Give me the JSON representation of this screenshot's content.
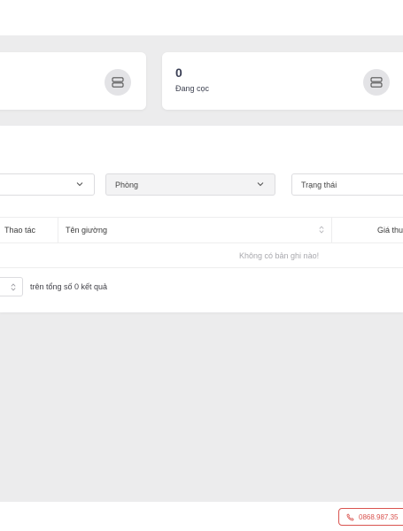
{
  "stats": [
    {
      "value": "",
      "label": "",
      "icon": "server-icon"
    },
    {
      "value": "0",
      "label": "Đang cọc",
      "icon": "server-icon"
    }
  ],
  "filters": {
    "filter_1": "",
    "room_placeholder": "Phòng",
    "status_placeholder": "Trạng thái"
  },
  "table": {
    "columns": [
      "Thao tác",
      "Tên giường",
      "Giá thu"
    ],
    "empty_message": "Không có bản ghi nào!"
  },
  "pagination": {
    "total_text": "trên tổng số 0 kết quả"
  },
  "footer": {
    "phone": "0868.987.35",
    "accent_color": "#d9534f"
  }
}
